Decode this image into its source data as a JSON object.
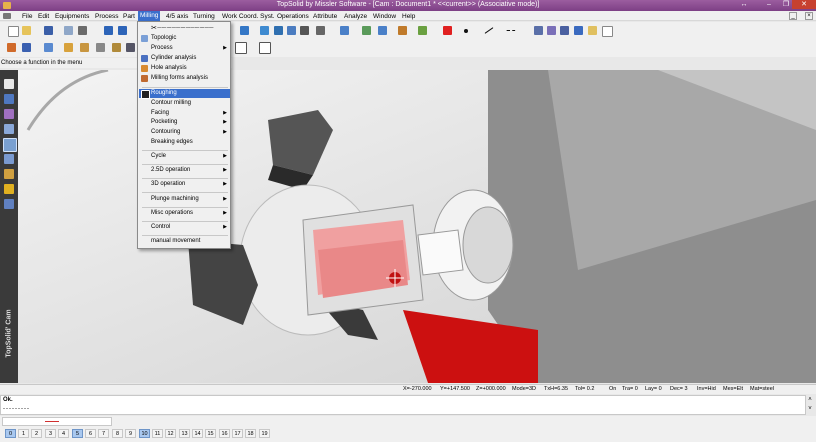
{
  "window": {
    "title": "TopSolid by Missler Software - [Cam : Document1 * <<current>> (Associative mode)]",
    "controls": [
      "↔",
      "–",
      "❐",
      "✕"
    ],
    "inner_controls": [
      "_",
      "×"
    ]
  },
  "menubar": {
    "items": [
      "File",
      "Edit",
      "Equipments",
      "Process",
      "Part",
      "Milling",
      "4/5 axis",
      "Turning",
      "Work Coord. Syst.",
      "Operations",
      "Attribute",
      "Analyze",
      "Window",
      "Help"
    ],
    "active": "Milling"
  },
  "hint": "Choose a function in the menu",
  "milling_menu": {
    "group1": [
      {
        "label": "Topologic",
        "submenu": false,
        "icon": "topologic-icon"
      },
      {
        "label": "Process",
        "submenu": true,
        "icon": ""
      },
      {
        "label": "Cylinder analysis",
        "submenu": false,
        "icon": "cylinder-icon"
      },
      {
        "label": "Hole analysis",
        "submenu": false,
        "icon": "hole-icon"
      },
      {
        "label": "Milling forms analysis",
        "submenu": false,
        "icon": "milling-forms-icon"
      }
    ],
    "group2": [
      {
        "label": "Roughing",
        "submenu": false,
        "highlight": true,
        "icon": "roughing-icon"
      },
      {
        "label": "Contour milling",
        "submenu": false
      },
      {
        "label": "Facing",
        "submenu": true
      },
      {
        "label": "Pocketing",
        "submenu": true
      },
      {
        "label": "Contouring",
        "submenu": true
      },
      {
        "label": "Breaking edges",
        "submenu": false
      }
    ],
    "group3": [
      {
        "label": "Cycle",
        "submenu": true
      },
      {
        "label": "2.5D operation",
        "submenu": true
      },
      {
        "label": "3D operation",
        "submenu": true
      },
      {
        "label": "Plunge machining",
        "submenu": true
      },
      {
        "label": "Misc operations",
        "submenu": true
      },
      {
        "label": "Control",
        "submenu": true
      },
      {
        "label": "manual movement",
        "submenu": false
      }
    ]
  },
  "left_brand": "TopSolid' Cam",
  "coords": {
    "x": "X=-270.000",
    "y": "Y=+147.500",
    "z": "Z=+000.000",
    "mode": "Mode=3D",
    "txh": "TxH=6.35",
    "tol": "Tol= 0.2",
    "on": "On",
    "tra": "Tra= 0",
    "lay": "Lay= 0",
    "dec": "Dec= 3",
    "inv": "Inv=Hid",
    "mes": "Mes=Elt",
    "mat": "Mat=steel"
  },
  "console": {
    "line1": "Ok.",
    "line2": "---------"
  },
  "pages": [
    "0",
    "1",
    "2",
    "3",
    "4",
    "5",
    "6",
    "7",
    "8",
    "9",
    "10",
    "11",
    "12",
    "13",
    "14",
    "15",
    "16",
    "17",
    "18",
    "19"
  ],
  "active_pages": [
    "0",
    "5",
    "10"
  ],
  "colors": {
    "titlebar": "#8a4c91",
    "highlight": "#3a6fcc",
    "red": "#cc1010",
    "pink": "#f0a0a0"
  }
}
